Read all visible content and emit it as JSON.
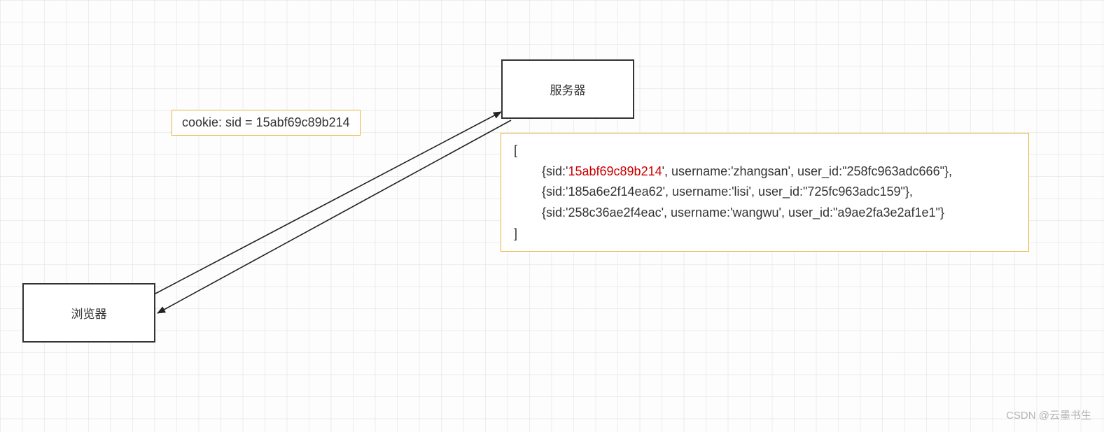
{
  "chart_data": {
    "type": "diagram",
    "nodes": [
      {
        "id": "server",
        "label": "服务器"
      },
      {
        "id": "browser",
        "label": "浏览器"
      }
    ],
    "edges": [
      {
        "from": "browser",
        "to": "server",
        "label": "cookie: sid = 15abf69c89b214"
      },
      {
        "from": "server",
        "to": "browser",
        "label": ""
      }
    ],
    "server_sessions": [
      {
        "sid": "15abf69c89b214",
        "username": "zhangsan",
        "user_id": "258fc963adc666",
        "highlight": true
      },
      {
        "sid": "185a6e2f14ea62",
        "username": "lisi",
        "user_id": "725fc963adc159",
        "highlight": false
      },
      {
        "sid": "258c36ae2f4eac",
        "username": "wangwu",
        "user_id": "a9ae2fa3e2af1e1",
        "highlight": false
      }
    ]
  },
  "server_label": "服务器",
  "browser_label": "浏览器",
  "cookie_label": "cookie: sid = 15abf69c89b214",
  "sessions": {
    "open": "[",
    "close": "]",
    "row0_pre": "{sid:'",
    "row0_sid": "15abf69c89b214",
    "row0_post": "', username:'zhangsan', user_id:\"258fc963adc666\"},",
    "row1": "{sid:'185a6e2f14ea62', username:'lisi', user_id:\"725fc963adc159\"},",
    "row2": "{sid:'258c36ae2f4eac', username:'wangwu', user_id:\"a9ae2fa3e2af1e1\"}"
  },
  "watermark": "CSDN @云墨书生"
}
